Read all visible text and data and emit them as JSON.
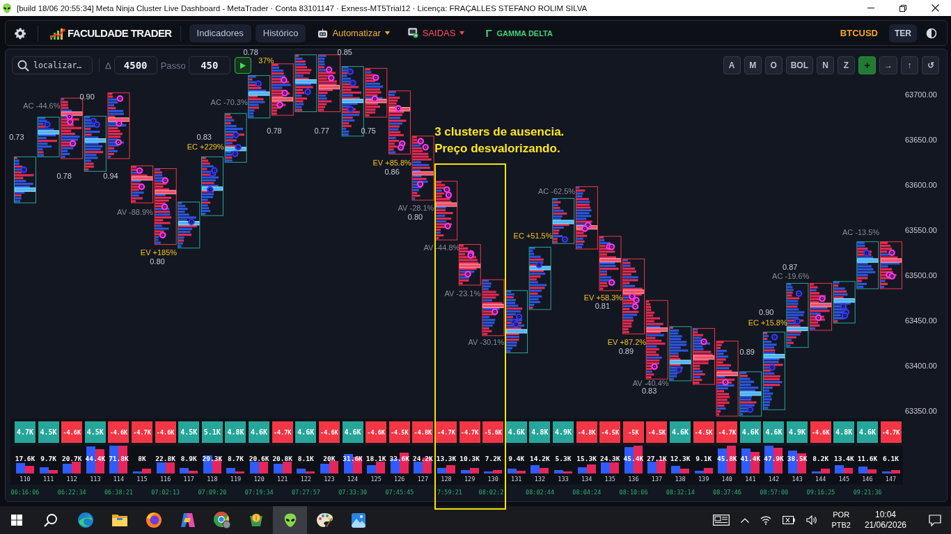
{
  "window": {
    "title": "[build 18/06 20:55:34] Meta Ninja Cluster Live Dashboard - MetaTrader · Conta 83101147 · Exness-MT5Trial12 · Licença: FRAÇALLES STEFANO ROLIM SILVA"
  },
  "nav": {
    "logo": "FACULDADE TRADER",
    "indicators": "Indicadores",
    "history": "Histórico",
    "automate": "Automatizar",
    "exits": "SAIDAS",
    "gamma_symbol": "Γ",
    "gamma": "GAMMA DELTA",
    "symbol": "BTCUSD",
    "theme": "TER"
  },
  "toolbar": {
    "search": {
      "placeholder": "localizar…"
    },
    "delta_label": "Δ",
    "delta": "4500",
    "step_label": "Passo",
    "step": "450",
    "buttons": [
      {
        "label": "A",
        "kind": "plain"
      },
      {
        "label": "M",
        "kind": "plain"
      },
      {
        "label": "O",
        "kind": "plain"
      },
      {
        "label": "BOL",
        "kind": "plain"
      },
      {
        "label": "N",
        "kind": "plain"
      },
      {
        "label": "Z",
        "kind": "plain"
      },
      {
        "label": "+",
        "kind": "accent"
      },
      {
        "label": "→",
        "kind": "plain"
      },
      {
        "label": "↑",
        "kind": "plain"
      },
      {
        "label": "↺",
        "kind": "plain"
      }
    ]
  },
  "chart": {
    "price_labels": [
      "63700.00",
      "63650.00",
      "63600.00",
      "63550.00",
      "63500.00",
      "63450.00",
      "63400.00",
      "63350.00"
    ],
    "labels": [
      {
        "text": "0.73",
        "kind": "ratio"
      },
      {
        "text": "AC -44.6%",
        "kind": "absorption"
      },
      {
        "text": "0.90",
        "kind": "ratio"
      },
      {
        "text": "0.78",
        "kind": "ratio"
      },
      {
        "text": "0.94",
        "kind": "ratio"
      },
      {
        "text": "AV -88.9%",
        "kind": "absorption"
      },
      {
        "text": "EV +185%",
        "kind": "exhaustion"
      },
      {
        "text": "0.80",
        "kind": "ratio"
      },
      {
        "text": "0.83",
        "kind": "ratio"
      },
      {
        "text": "EC +229%",
        "kind": "exhaustion"
      },
      {
        "text": "AC -70.3%",
        "kind": "absorption"
      },
      {
        "text": "0.78",
        "kind": "ratio"
      },
      {
        "text": "37%",
        "kind": "exhaustion"
      },
      {
        "text": "0.78",
        "kind": "ratio"
      },
      {
        "text": "0.77",
        "kind": "ratio"
      },
      {
        "text": "0.85",
        "kind": "ratio"
      },
      {
        "text": "0.75",
        "kind": "ratio"
      },
      {
        "text": "EV +85.8%",
        "kind": "exhaustion"
      },
      {
        "text": "0.86",
        "kind": "ratio"
      },
      {
        "text": "AV -28.1%",
        "kind": "absorption"
      },
      {
        "text": "0.80",
        "kind": "ratio"
      },
      {
        "text": "AV -44.8%",
        "kind": "absorption"
      },
      {
        "text": "AV -23.1%",
        "kind": "absorption"
      },
      {
        "text": "AV -30.1%",
        "kind": "absorption"
      },
      {
        "text": "EC +51.5%",
        "kind": "exhaustion"
      },
      {
        "text": "AC -62.5%",
        "kind": "absorption"
      },
      {
        "text": "EV +58.3%",
        "kind": "exhaustion"
      },
      {
        "text": "0.81",
        "kind": "ratio"
      },
      {
        "text": "EV +87.2%",
        "kind": "exhaustion"
      },
      {
        "text": "0.89",
        "kind": "ratio"
      },
      {
        "text": "AV -40.4%",
        "kind": "absorption"
      },
      {
        "text": "0.83",
        "kind": "ratio"
      },
      {
        "text": "0.89",
        "kind": "ratio"
      },
      {
        "text": "0.90",
        "kind": "ratio"
      },
      {
        "text": "EC +15.8%",
        "kind": "exhaustion"
      },
      {
        "text": "0.87",
        "kind": "ratio"
      },
      {
        "text": "AC -19.6%",
        "kind": "absorption"
      },
      {
        "text": "AC -13.5%",
        "kind": "absorption"
      }
    ],
    "note": "3 clusters de ausencia.\nPreço desvalorizando."
  },
  "delta": [
    {
      "value": "4.7K",
      "color": "#26a69a"
    },
    {
      "value": "4.5K",
      "color": "#26a69a"
    },
    {
      "value": "-4.6K",
      "color": "#f23645"
    },
    {
      "value": "4.5K",
      "color": "#26a69a"
    },
    {
      "value": "-4.6K",
      "color": "#f23645"
    },
    {
      "value": "-4.7K",
      "color": "#f23645"
    },
    {
      "value": "-4.6K",
      "color": "#f23645"
    },
    {
      "value": "4.5K",
      "color": "#26a69a"
    },
    {
      "value": "5.1K",
      "color": "#26a69a"
    },
    {
      "value": "4.8K",
      "color": "#26a69a"
    },
    {
      "value": "4.6K",
      "color": "#26a69a"
    },
    {
      "value": "-4.7K",
      "color": "#f23645"
    },
    {
      "value": "4.6K",
      "color": "#26a69a"
    },
    {
      "value": "-4.6K",
      "color": "#f23645"
    },
    {
      "value": "4.6K",
      "color": "#26a69a"
    },
    {
      "value": "-4.6K",
      "color": "#f23645"
    },
    {
      "value": "-4.5K",
      "color": "#f23645"
    },
    {
      "value": "-4.8K",
      "color": "#f23645"
    },
    {
      "value": "-4.7K",
      "color": "#f23645"
    },
    {
      "value": "-4.7K",
      "color": "#f23645"
    },
    {
      "value": "-5.6K",
      "color": "#f23645"
    },
    {
      "value": "4.6K",
      "color": "#26a69a"
    },
    {
      "value": "4.8K",
      "color": "#26a69a"
    },
    {
      "value": "4.9K",
      "color": "#26a69a"
    },
    {
      "value": "-4.8K",
      "color": "#f23645"
    },
    {
      "value": "-4.5K",
      "color": "#f23645"
    },
    {
      "value": "-5K",
      "color": "#f23645"
    },
    {
      "value": "-4.5K",
      "color": "#f23645"
    },
    {
      "value": "4.6K",
      "color": "#26a69a"
    },
    {
      "value": "-4.5K",
      "color": "#f23645"
    },
    {
      "value": "-4.7K",
      "color": "#f23645"
    },
    {
      "value": "4.6K",
      "color": "#26a69a"
    },
    {
      "value": "4.6K",
      "color": "#26a69a"
    },
    {
      "value": "4.9K",
      "color": "#26a69a"
    },
    {
      "value": "-4.6K",
      "color": "#f23645"
    },
    {
      "value": "4.8K",
      "color": "#26a69a"
    },
    {
      "value": "4.6K",
      "color": "#26a69a"
    },
    {
      "value": "-4.7K",
      "color": "#f23645"
    }
  ],
  "volume": [
    "17.6K",
    "9.7K",
    "20.7K",
    "44.4K",
    "71.8K",
    "8K",
    "22.8K",
    "8.9K",
    "29.3K",
    "8.7K",
    "20.6K",
    "20.8K",
    "8.1K",
    "20K",
    "31.6K",
    "18.1K",
    "33.6K",
    "24.2K",
    "13.3K",
    "10.3K",
    "7.2K",
    "9.4K",
    "14.2K",
    "5.3K",
    "15.3K",
    "24.3K",
    "45.4K",
    "27.1K",
    "12.3K",
    "9.1K",
    "45.8K",
    "41.4K",
    "47.9K",
    "38.5K",
    "8.2K",
    "13.4K",
    "11.6K",
    "6.1K"
  ],
  "bar_numbers": [
    "110",
    "111",
    "112",
    "113",
    "114",
    "115",
    "116",
    "117",
    "118",
    "119",
    "120",
    "121",
    "122",
    "123",
    "124",
    "125",
    "126",
    "127",
    "128",
    "129",
    "130",
    "131",
    "132",
    "133",
    "134",
    "135",
    "136",
    "137",
    "138",
    "139",
    "140",
    "141",
    "142",
    "143",
    "144",
    "145",
    "146",
    "147"
  ],
  "times": [
    "06:16:06",
    "06:22:34",
    "06:38:21",
    "07:02:13",
    "07:09:20",
    "07:19:34",
    "07:27:57",
    "07:33:30",
    "07:45:45",
    "7:59:21",
    "08:02:2",
    "08:02:44",
    "08:04:24",
    "08:10:06",
    "08:32:14",
    "08:37:46",
    "08:57:00",
    "09:16:25",
    "09:21:36"
  ],
  "taskbar": {
    "apps": [
      {
        "kind": "edge",
        "selected": false
      },
      {
        "kind": "folder",
        "selected": false
      },
      {
        "kind": "firefox",
        "selected": false
      },
      {
        "kind": "copilot",
        "selected": false
      },
      {
        "kind": "chrome",
        "selected": false
      },
      {
        "kind": "coin",
        "selected": false
      },
      {
        "kind": "alien",
        "selected": true
      },
      {
        "kind": "palette",
        "selected": false
      },
      {
        "kind": "photos",
        "selected": false
      }
    ],
    "language": "POR",
    "layout": "PTB2",
    "time": "10:04",
    "date": "21/06/2026"
  }
}
